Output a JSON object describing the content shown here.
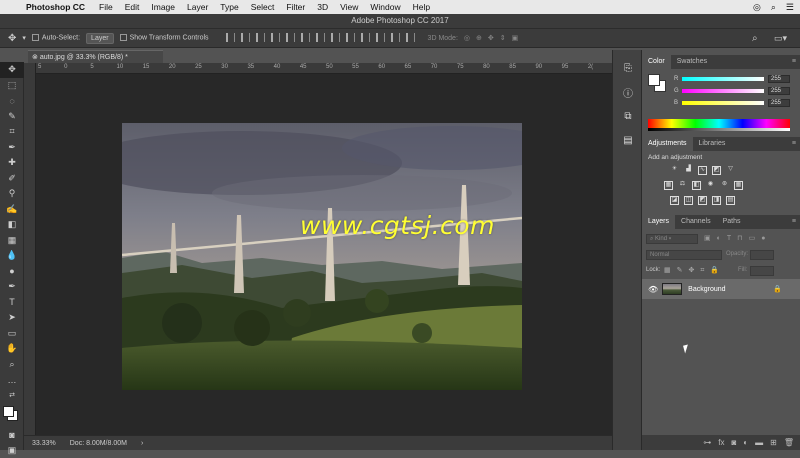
{
  "menubar": {
    "app": "Photoshop CC",
    "items": [
      "File",
      "Edit",
      "Image",
      "Layer",
      "Type",
      "Select",
      "Filter",
      "3D",
      "View",
      "Window",
      "Help"
    ]
  },
  "window_title": "Adobe Photoshop CC 2017",
  "options_bar": {
    "auto_select_label": "Auto-Select:",
    "auto_select_value": "Layer",
    "show_transform_label": "Show Transform Controls",
    "mode_3d_label": "3D Mode:"
  },
  "document": {
    "tab_label": "auto.jpg @ 33.3% (RGB/8) *",
    "watermark": "www.cgtsj.com"
  },
  "ruler_ticks": [
    "5",
    "0",
    "5",
    "10",
    "15",
    "20",
    "25",
    "30",
    "35",
    "40",
    "45",
    "50",
    "55",
    "60",
    "65",
    "70",
    "75",
    "80",
    "85",
    "90",
    "95",
    "2("
  ],
  "status": {
    "zoom": "33.33%",
    "doc": "Doc: 8.00M/8.00M"
  },
  "color_panel": {
    "tabs": [
      "Color",
      "Swatches"
    ],
    "channels": [
      {
        "label": "R",
        "value": "255",
        "gradient": "#00ffff,#ffffff"
      },
      {
        "label": "G",
        "value": "255",
        "gradient": "#ff00ff,#ffffff"
      },
      {
        "label": "B",
        "value": "255",
        "gradient": "#ffff00,#ffffff"
      }
    ]
  },
  "adjustments_panel": {
    "tabs": [
      "Adjustments",
      "Libraries"
    ],
    "heading": "Add an adjustment"
  },
  "layers_panel": {
    "tabs": [
      "Layers",
      "Channels",
      "Paths"
    ],
    "kind_placeholder": "Kind",
    "blend_mode": "Normal",
    "opacity_label": "Opacity:",
    "lock_label": "Lock:",
    "fill_label": "Fill:",
    "layer_name": "Background"
  },
  "colors": {
    "panel_bg": "#535353",
    "watermark": "#ffff33"
  }
}
